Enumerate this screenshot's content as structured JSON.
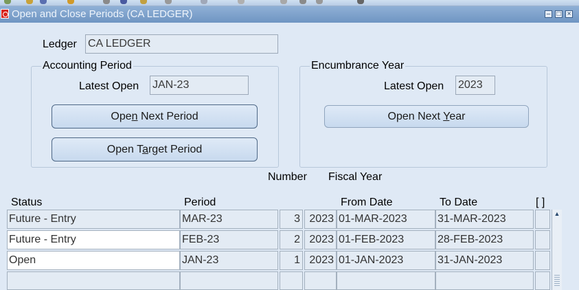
{
  "window": {
    "title": "Open and Close Periods (CA LEDGER)"
  },
  "ledger": {
    "label": "Ledger",
    "value": "CA LEDGER"
  },
  "accounting_period": {
    "group_title": "Accounting Period",
    "latest_open_label": "Latest Open",
    "latest_open_value": "JAN-23",
    "open_next_button": {
      "pre": "Ope",
      "mnemonic": "n",
      "post": " Next Period"
    },
    "open_target_button": {
      "pre": "Open T",
      "mnemonic": "a",
      "post": "rget Period"
    }
  },
  "encumbrance_year": {
    "group_title": "Encumbrance Year",
    "latest_open_label": "Latest Open",
    "latest_open_value": "2023",
    "open_next_button": {
      "pre": "Open Next ",
      "mnemonic": "Y",
      "post": "ear"
    }
  },
  "table": {
    "headers": {
      "status": "Status",
      "period": "Period",
      "number": "Number",
      "fiscal_year": "Fiscal Year",
      "from_date": "From Date",
      "to_date": "To Date",
      "flex": "[ ]"
    },
    "rows": [
      {
        "status": "Future - Entry",
        "period": "MAR-23",
        "number": "3",
        "fiscal_year": "2023",
        "from_date": "01-MAR-2023",
        "to_date": "31-MAR-2023"
      },
      {
        "status": "Future - Entry",
        "period": "FEB-23",
        "number": "2",
        "fiscal_year": "2023",
        "from_date": "01-FEB-2023",
        "to_date": "28-FEB-2023"
      },
      {
        "status": "Open",
        "period": "JAN-23",
        "number": "1",
        "fiscal_year": "2023",
        "from_date": "01-JAN-2023",
        "to_date": "31-JAN-2023"
      },
      {
        "status": "",
        "period": "",
        "number": "",
        "fiscal_year": "",
        "from_date": "",
        "to_date": ""
      }
    ]
  },
  "colors": {
    "titlebar": "#7fa3cd",
    "background": "#dfe9f5",
    "field": "#e3ebf4",
    "button": "#cfe0f2"
  }
}
